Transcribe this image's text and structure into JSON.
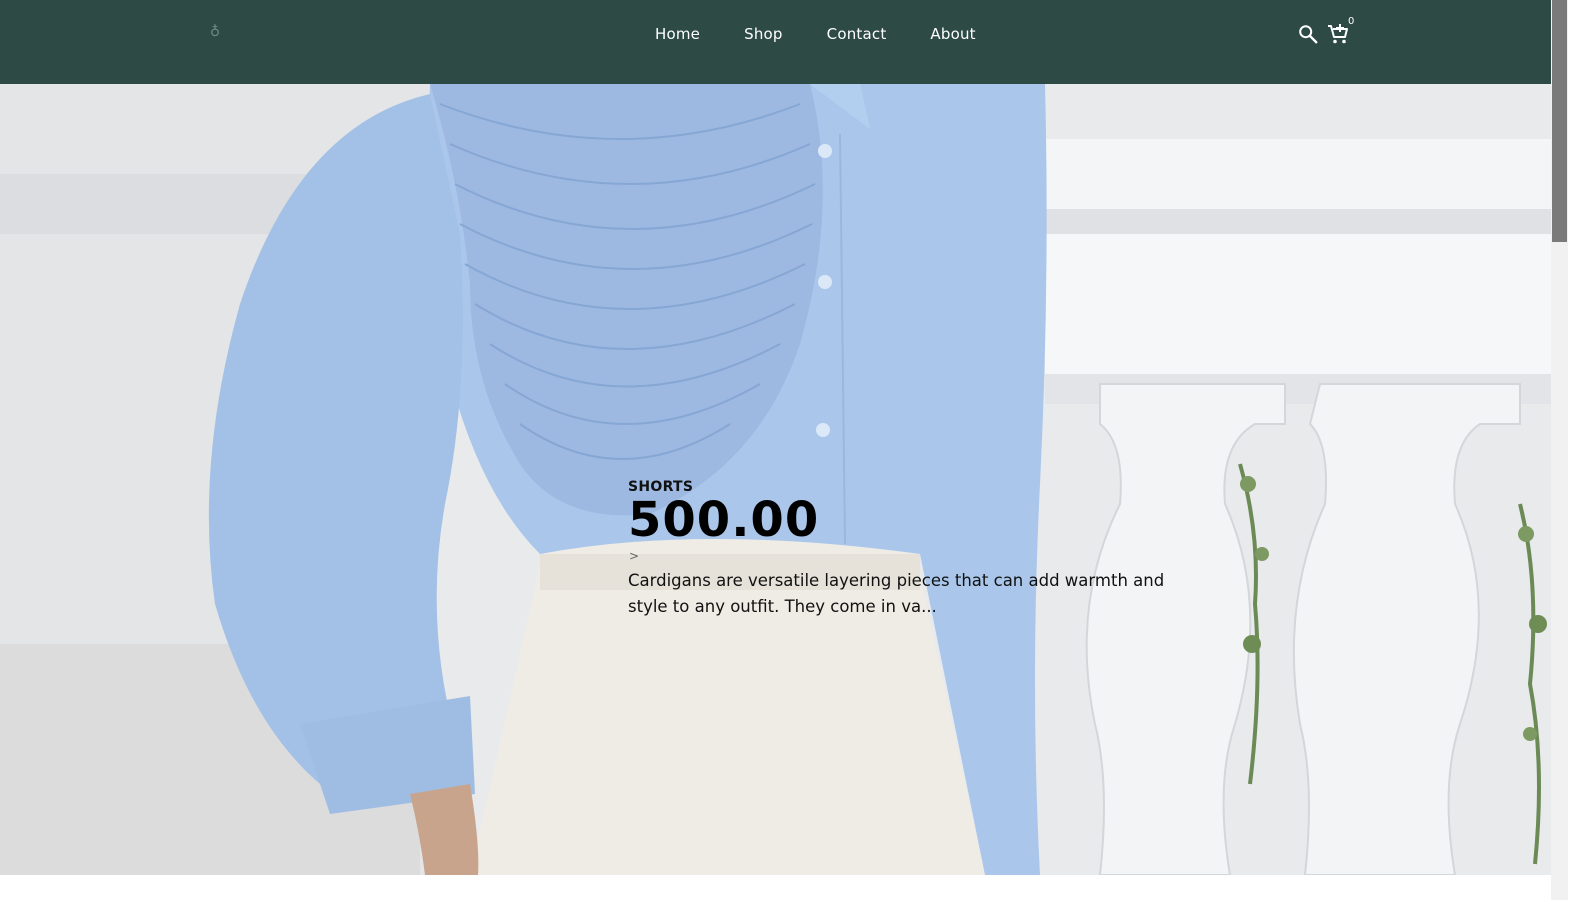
{
  "header": {
    "logo_glyph": "♁",
    "nav": [
      {
        "label": "Home"
      },
      {
        "label": "Shop"
      },
      {
        "label": "Contact"
      },
      {
        "label": "About"
      }
    ],
    "cart_count": "0",
    "icons": [
      "search-icon",
      "cart-icon"
    ]
  },
  "hero": {
    "category": "SHORTS",
    "price": "500.00",
    "arrow": ">",
    "description": "Cardigans are versatile layering pieces that can add warmth and style to any outfit. They come in va..."
  },
  "colors": {
    "header_bg": "#2d4a45",
    "shirt": "#a9c6ea",
    "skirt": "#efece6",
    "balustrade": "#f2f3f5"
  }
}
